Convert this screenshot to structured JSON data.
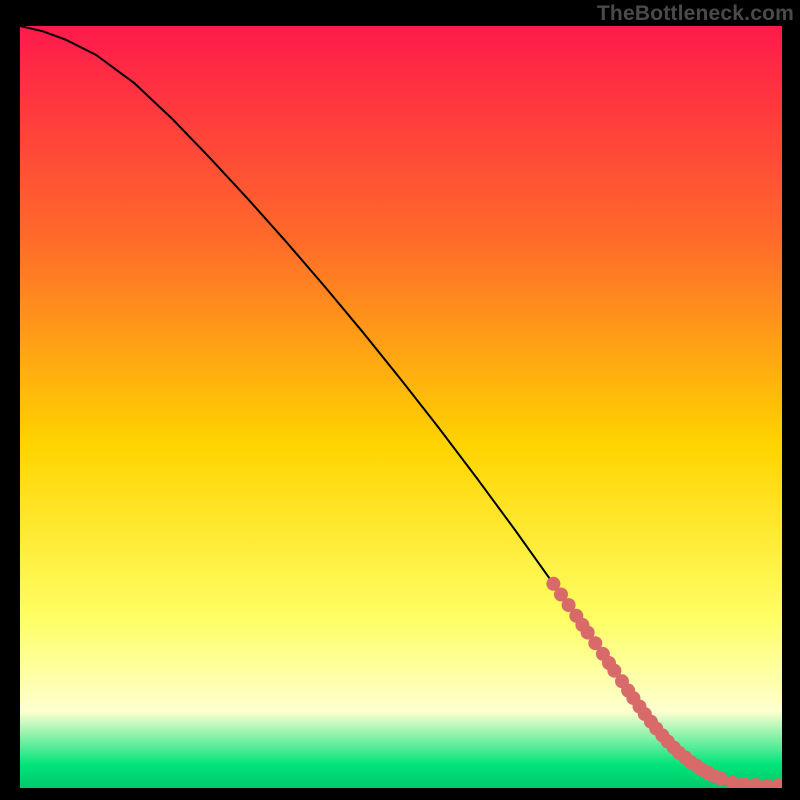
{
  "watermark": "TheBottleneck.com",
  "colors": {
    "gradient_top": "#ff1a4b",
    "gradient_mid_top": "#ff6a2a",
    "gradient_mid": "#ffd400",
    "gradient_low": "#ffff66",
    "gradient_pale": "#fdffd0",
    "gradient_green": "#00e37a",
    "curve": "#000000",
    "dots": "#d86a6a"
  },
  "chart_data": {
    "type": "line",
    "title": "",
    "xlabel": "",
    "ylabel": "",
    "xlim": [
      0,
      100
    ],
    "ylim": [
      0,
      100
    ],
    "curve": {
      "x": [
        0,
        3,
        6,
        10,
        15,
        20,
        25,
        30,
        35,
        40,
        45,
        50,
        55,
        60,
        65,
        70,
        75,
        80,
        82,
        84,
        86,
        88,
        90,
        92,
        94,
        96,
        98,
        100
      ],
      "y": [
        100,
        99.3,
        98.2,
        96.2,
        92.5,
        87.8,
        82.6,
        77.2,
        71.6,
        65.8,
        59.8,
        53.6,
        47.2,
        40.6,
        33.8,
        26.8,
        19.6,
        12.2,
        9.2,
        6.6,
        4.4,
        2.7,
        1.5,
        0.8,
        0.4,
        0.2,
        0.1,
        0.3
      ]
    },
    "dots": {
      "x": [
        70,
        71,
        72,
        73,
        73.8,
        74.5,
        75.5,
        76.5,
        77.3,
        78,
        79,
        79.8,
        80.5,
        81.3,
        82,
        82.8,
        83.5,
        84.3,
        85,
        85.8,
        86.5,
        87.3,
        88,
        88.8,
        89.5,
        90.3,
        91,
        92,
        93.5,
        95,
        96.5,
        98,
        99.5
      ],
      "y": [
        26.8,
        25.4,
        24,
        22.6,
        21.4,
        20.4,
        19,
        17.6,
        16.4,
        15.4,
        14,
        12.8,
        11.8,
        10.7,
        9.7,
        8.7,
        7.8,
        6.9,
        6.1,
        5.3,
        4.6,
        4,
        3.4,
        2.9,
        2.4,
        2,
        1.6,
        1.2,
        0.7,
        0.5,
        0.4,
        0.3,
        0.35
      ]
    }
  }
}
